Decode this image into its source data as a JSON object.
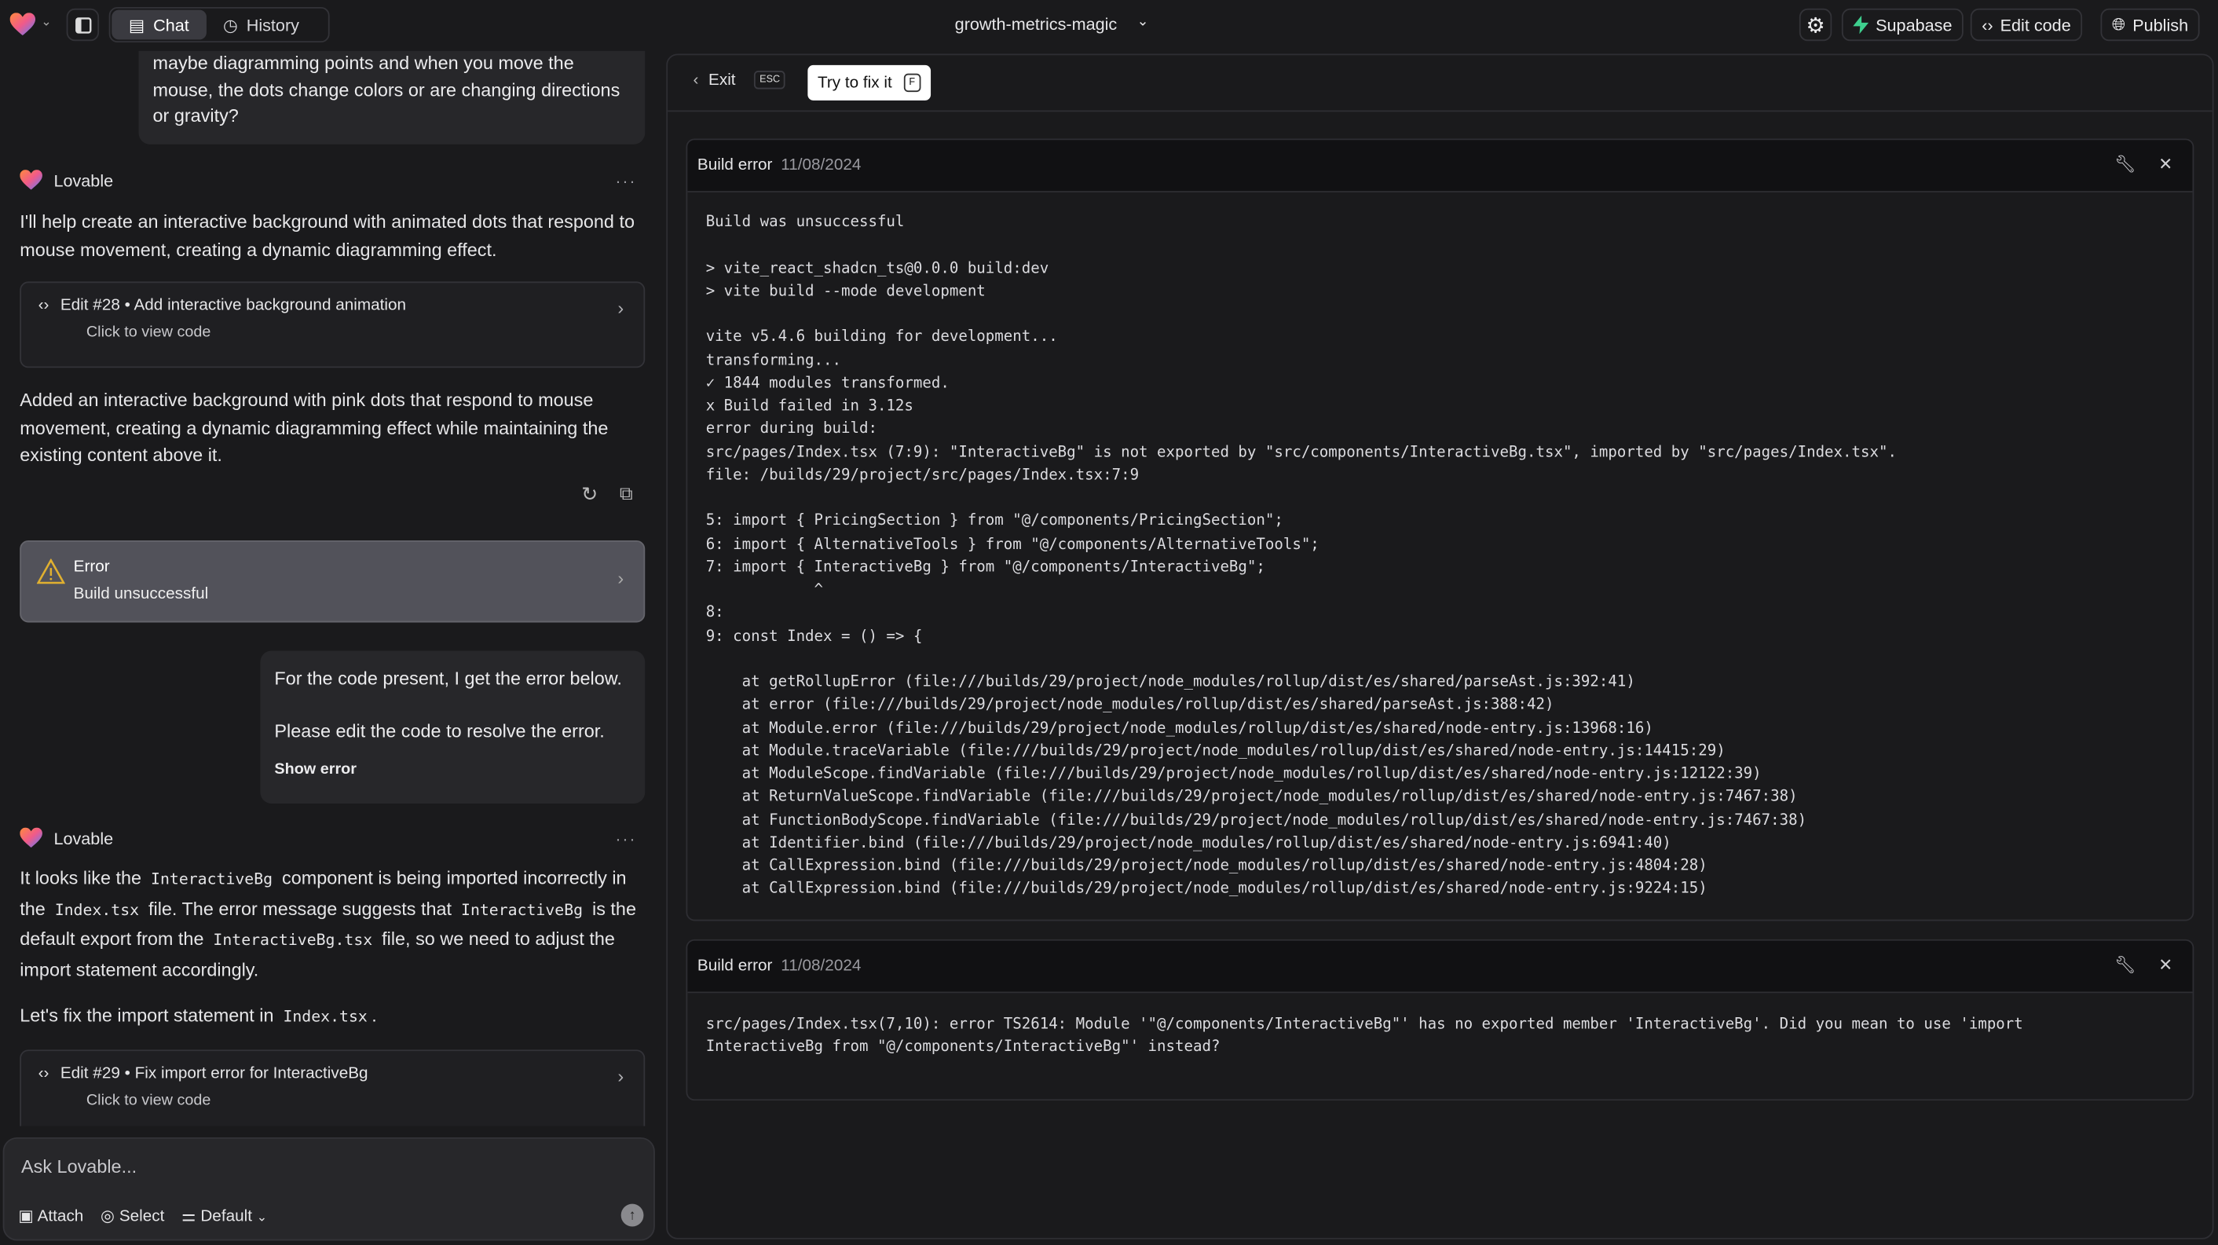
{
  "topbar": {
    "project_name": "growth-metrics-magic",
    "tabs": [
      {
        "label": "Chat",
        "active": true
      },
      {
        "label": "History",
        "active": false
      }
    ],
    "buttons": {
      "supabase": "Supabase",
      "edit_code": "Edit code",
      "publish": "Publish"
    },
    "colors": {
      "supabase": "#3ecf8e"
    }
  },
  "chat": {
    "user_msg_1": "maybe diagramming points and when you move the mouse, the dots change colors or are changing directions or gravity?",
    "assistant_name": "Lovable",
    "reply_1": "I'll help create an interactive background with animated dots that respond to mouse movement, creating a dynamic diagramming effect.",
    "edit_1": {
      "title": "Edit #28 • Add interactive background animation",
      "subtitle": "Click to view code"
    },
    "reply_2": "Added an interactive background with pink dots that respond to mouse movement, creating a dynamic diagramming effect while maintaining the existing content above it.",
    "error_card": {
      "title": "Error",
      "subtitle": "Build unsuccessful",
      "icon_color": "#e0b030"
    },
    "user_msg_2": {
      "line1": "For the code present, I get the error below.",
      "line2": "Please edit the code to resolve the error.",
      "link": "Show error"
    },
    "reply_3": {
      "p1": "It looks like the",
      "c1": "InteractiveBg",
      "p2": "component is being imported incorrectly in the",
      "c2": "Index.tsx",
      "p3": "file. The error message suggests that",
      "c3": "InteractiveBg",
      "p4": "is the default export from the",
      "c4": "InteractiveBg.tsx",
      "p5": "file, so we need to adjust the import statement accordingly.",
      "p6": "Let's fix the import statement in",
      "c6": "Index.tsx",
      "p7": "."
    },
    "edit_2": {
      "title": "Edit #29 • Fix import error for InteractiveBg",
      "subtitle": "Click to view code"
    }
  },
  "input": {
    "placeholder": "Ask Lovable...",
    "attach": "Attach",
    "select": "Select",
    "mode": "Default"
  },
  "panel": {
    "exit": "Exit",
    "exit_key": "ESC",
    "fix": "Try to fix it",
    "fix_key": "F",
    "errors": [
      {
        "title": "Build error",
        "date": "11/08/2024",
        "log": "Build was unsuccessful\n\n> vite_react_shadcn_ts@0.0.0 build:dev\n> vite build --mode development\n\nvite v5.4.6 building for development...\ntransforming...\n✓ 1844 modules transformed.\nx Build failed in 3.12s\nerror during build:\nsrc/pages/Index.tsx (7:9): \"InteractiveBg\" is not exported by \"src/components/InteractiveBg.tsx\", imported by \"src/pages/Index.tsx\".\nfile: /builds/29/project/src/pages/Index.tsx:7:9\n\n5: import { PricingSection } from \"@/components/PricingSection\";\n6: import { AlternativeTools } from \"@/components/AlternativeTools\";\n7: import { InteractiveBg } from \"@/components/InteractiveBg\";\n            ^\n8:\n9: const Index = () => {\n\n    at getRollupError (file:///builds/29/project/node_modules/rollup/dist/es/shared/parseAst.js:392:41)\n    at error (file:///builds/29/project/node_modules/rollup/dist/es/shared/parseAst.js:388:42)\n    at Module.error (file:///builds/29/project/node_modules/rollup/dist/es/shared/node-entry.js:13968:16)\n    at Module.traceVariable (file:///builds/29/project/node_modules/rollup/dist/es/shared/node-entry.js:14415:29)\n    at ModuleScope.findVariable (file:///builds/29/project/node_modules/rollup/dist/es/shared/node-entry.js:12122:39)\n    at ReturnValueScope.findVariable (file:///builds/29/project/node_modules/rollup/dist/es/shared/node-entry.js:7467:38)\n    at FunctionBodyScope.findVariable (file:///builds/29/project/node_modules/rollup/dist/es/shared/node-entry.js:7467:38)\n    at Identifier.bind (file:///builds/29/project/node_modules/rollup/dist/es/shared/node-entry.js:6941:40)\n    at CallExpression.bind (file:///builds/29/project/node_modules/rollup/dist/es/shared/node-entry.js:4804:28)\n    at CallExpression.bind (file:///builds/29/project/node_modules/rollup/dist/es/shared/node-entry.js:9224:15)"
      },
      {
        "title": "Build error",
        "date": "11/08/2024",
        "log": "src/pages/Index.tsx(7,10): error TS2614: Module '\"@/components/InteractiveBg\"' has no exported member 'InteractiveBg'. Did you mean to use 'import\nInteractiveBg from \"@/components/InteractiveBg\"' instead?"
      }
    ]
  }
}
